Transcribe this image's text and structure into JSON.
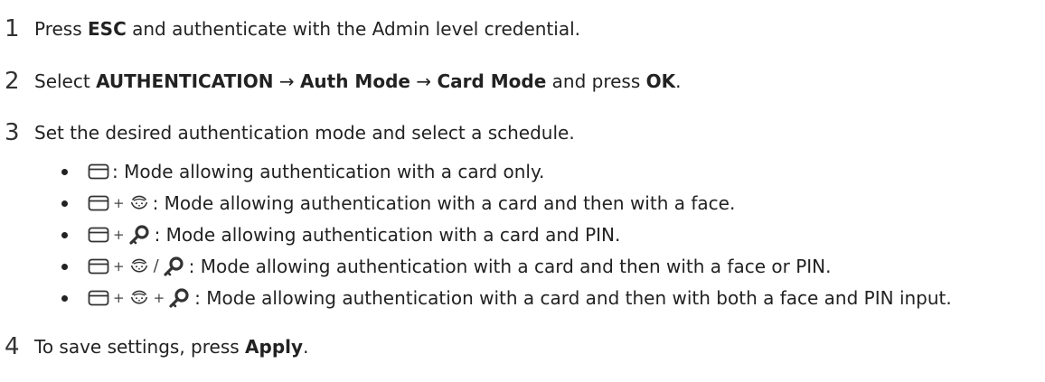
{
  "steps": [
    {
      "number": "1",
      "parts": [
        {
          "text": "Press ",
          "bold": false
        },
        {
          "text": "ESC",
          "bold": true
        },
        {
          "text": " and authenticate with the Admin level credential.",
          "bold": false
        }
      ]
    },
    {
      "number": "2",
      "parts": [
        {
          "text": "Select ",
          "bold": false
        },
        {
          "text": "AUTHENTICATION",
          "bold": true
        },
        {
          "text": " → ",
          "bold": false
        },
        {
          "text": "Auth Mode",
          "bold": true
        },
        {
          "text": " → ",
          "bold": false
        },
        {
          "text": "Card Mode",
          "bold": true
        },
        {
          "text": " and press ",
          "bold": false
        },
        {
          "text": "OK",
          "bold": true
        },
        {
          "text": ".",
          "bold": false
        }
      ]
    },
    {
      "number": "3",
      "parts": [
        {
          "text": "Set the desired authentication mode and select a schedule.",
          "bold": false
        }
      ]
    },
    {
      "number": "4",
      "parts": [
        {
          "text": "To save settings, press ",
          "bold": false
        },
        {
          "text": "Apply",
          "bold": true
        },
        {
          "text": ".",
          "bold": false
        }
      ]
    }
  ],
  "modes": [
    {
      "icons": [
        "card-icon"
      ],
      "separators": [],
      "description": ": Mode allowing authentication with a card only."
    },
    {
      "icons": [
        "card-icon",
        "face-icon"
      ],
      "separators": [
        "+"
      ],
      "description": ": Mode allowing authentication with a card and then with a face."
    },
    {
      "icons": [
        "card-icon",
        "key-icon"
      ],
      "separators": [
        "+"
      ],
      "description": ": Mode allowing authentication with a card and PIN."
    },
    {
      "icons": [
        "card-icon",
        "face-icon",
        "key-icon"
      ],
      "separators": [
        "+",
        "/"
      ],
      "description": ": Mode allowing authentication with a card and then with a face or PIN."
    },
    {
      "icons": [
        "card-icon",
        "face-icon",
        "key-icon"
      ],
      "separators": [
        "+",
        "+"
      ],
      "description": ": Mode allowing authentication with a card and then with both a face and PIN input."
    }
  ]
}
